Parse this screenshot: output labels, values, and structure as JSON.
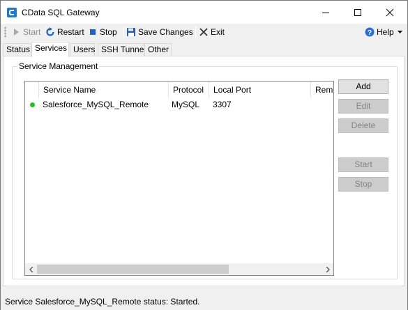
{
  "window": {
    "title": "CData SQL Gateway",
    "icon": "cdata-app-icon",
    "controls": [
      "minimize-icon",
      "maximize-icon",
      "close-icon"
    ]
  },
  "toolbar": {
    "start_label": "Start",
    "restart_label": "Restart",
    "stop_label": "Stop",
    "save_label": "Save Changes",
    "exit_label": "Exit",
    "help_label": "Help"
  },
  "tabs": [
    {
      "label": "Status"
    },
    {
      "label": "Services"
    },
    {
      "label": "Users"
    },
    {
      "label": "SSH Tunnel"
    },
    {
      "label": "Other"
    }
  ],
  "active_tab": "Services",
  "group": {
    "title": "Service Management"
  },
  "list": {
    "columns": [
      "Service Name",
      "Protocol",
      "Local Port",
      "Remo"
    ],
    "rows": [
      {
        "status": "started",
        "service_name": "Salesforce_MySQL_Remote",
        "protocol": "MySQL",
        "local_port": "3307",
        "remote": ""
      }
    ]
  },
  "side_buttons": {
    "add": "Add",
    "edit": "Edit",
    "delete": "Delete",
    "start": "Start",
    "stop": "Stop"
  },
  "colors": {
    "status_started": "#22c022",
    "accent_blue": "#1e64c8"
  },
  "statusbar": {
    "text": "Service Salesforce_MySQL_Remote status: Started."
  }
}
